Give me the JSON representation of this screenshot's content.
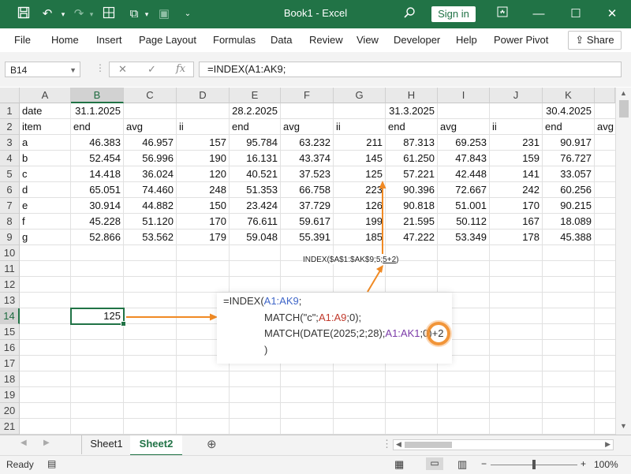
{
  "app": {
    "title": "Book1 - Excel",
    "sign_in": "Sign in",
    "share": "Share"
  },
  "ribbon_tabs": [
    "File",
    "Home",
    "Insert",
    "Page Layout",
    "Formulas",
    "Data",
    "Review",
    "View",
    "Developer",
    "Help",
    "Power Pivot"
  ],
  "formula_bar": {
    "name_box": "B14",
    "formula": "=INDEX(A1:AK9;"
  },
  "columns": [
    "A",
    "B",
    "C",
    "D",
    "E",
    "F",
    "G",
    "H",
    "I",
    "J",
    "K"
  ],
  "rows": [
    "1",
    "2",
    "3",
    "4",
    "5",
    "6",
    "7",
    "8",
    "9",
    "10",
    "11",
    "12",
    "13",
    "14",
    "15",
    "16",
    "17",
    "18",
    "19",
    "20",
    "21"
  ],
  "cells": {
    "r1": [
      "date",
      "31.1.2025",
      "",
      "",
      "28.2.2025",
      "",
      "",
      "31.3.2025",
      "",
      "",
      "30.4.2025"
    ],
    "r2": [
      "item",
      "end",
      "avg",
      "ii",
      "end",
      "avg",
      "ii",
      "end",
      "avg",
      "ii",
      "end"
    ],
    "r2_extra": "avg",
    "data": [
      [
        "a",
        "46.383",
        "46.957",
        "157",
        "95.784",
        "63.232",
        "211",
        "87.313",
        "69.253",
        "231",
        "90.917"
      ],
      [
        "b",
        "52.454",
        "56.996",
        "190",
        "16.131",
        "43.374",
        "145",
        "61.250",
        "47.843",
        "159",
        "76.727"
      ],
      [
        "c",
        "14.418",
        "36.024",
        "120",
        "40.521",
        "37.523",
        "125",
        "57.221",
        "42.448",
        "141",
        "33.057"
      ],
      [
        "d",
        "65.051",
        "74.460",
        "248",
        "51.353",
        "66.758",
        "223",
        "90.396",
        "72.667",
        "242",
        "60.256"
      ],
      [
        "e",
        "30.914",
        "44.882",
        "150",
        "23.424",
        "37.729",
        "126",
        "90.818",
        "51.001",
        "170",
        "90.215"
      ],
      [
        "f",
        "45.228",
        "51.120",
        "170",
        "76.611",
        "59.617",
        "199",
        "21.595",
        "50.112",
        "167",
        "18.089"
      ],
      [
        "g",
        "52.866",
        "53.562",
        "179",
        "59.048",
        "55.391",
        "185",
        "47.222",
        "53.349",
        "178",
        "45.388"
      ]
    ],
    "b14": "125"
  },
  "annotation": {
    "small_note_a": "INDEX($A$1:$AK$9;5;",
    "small_note_b": "5+2",
    "small_note_c": ")",
    "line1_a": "=INDEX(",
    "line1_ref": "A1:AK9",
    "line1_b": ";",
    "line2_a": "MATCH(\"c\";",
    "line2_ref": "A1:A9",
    "line2_b": ";0);",
    "line3_a": "MATCH(DATE(2025;2;28);",
    "line3_ref": "A1:AK1",
    "line3_b": ";0)",
    "line3_c": "+2",
    "line4": ")"
  },
  "sheets": [
    "Sheet1",
    "Sheet2"
  ],
  "active_sheet": "Sheet2",
  "status": {
    "ready": "Ready",
    "zoom": "100%"
  },
  "colors": {
    "excel_green": "#217346",
    "annotation_orange": "#f08a24",
    "ref_blue": "#3f66c8",
    "ref_red": "#c0392b",
    "ref_purple": "#7b3aa8"
  },
  "icons": [
    "save-icon",
    "undo-icon",
    "redo-icon",
    "table-icon",
    "paste-icon",
    "form-icon",
    "customize-icon",
    "search-icon",
    "ribbon-display-icon",
    "minimize-icon",
    "maximize-icon",
    "close-icon",
    "share-icon",
    "cancel-icon",
    "enter-icon",
    "fx-icon",
    "add-sheet-icon"
  ]
}
